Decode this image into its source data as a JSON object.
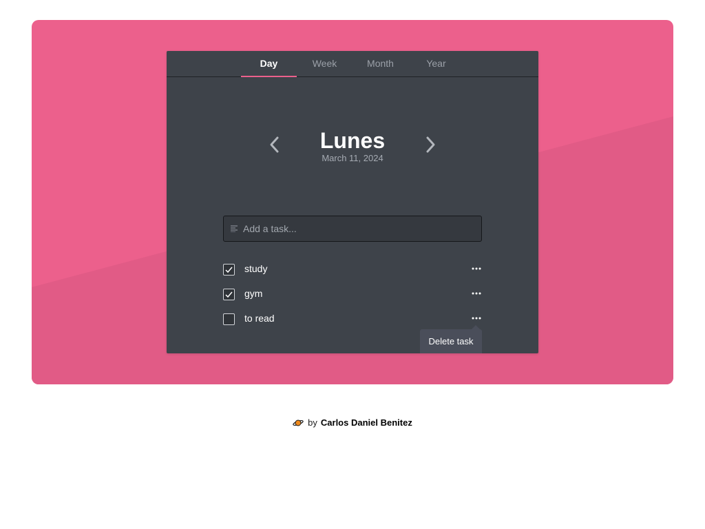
{
  "tabs": [
    {
      "label": "Day",
      "active": true
    },
    {
      "label": "Week",
      "active": false
    },
    {
      "label": "Month",
      "active": false
    },
    {
      "label": "Year",
      "active": false
    }
  ],
  "day": {
    "title": "Lunes",
    "date": "March 11, 2024"
  },
  "add_task": {
    "placeholder": "Add a task..."
  },
  "tasks": [
    {
      "label": "study",
      "checked": true
    },
    {
      "label": "gym",
      "checked": true
    },
    {
      "label": "to read",
      "checked": false
    }
  ],
  "tooltip": {
    "label": "Delete task"
  },
  "footer": {
    "by": "by",
    "author": "Carlos Daniel Benitez"
  },
  "colors": {
    "background": "#ec608c",
    "panel": "#3e434a",
    "accent": "#ec608c"
  },
  "icons": {
    "previous": "chevron-left-icon",
    "next": "chevron-right-icon",
    "add_task": "lines-icon",
    "task_menu": "more-dots-icon",
    "footer_logo": "planet-icon"
  }
}
